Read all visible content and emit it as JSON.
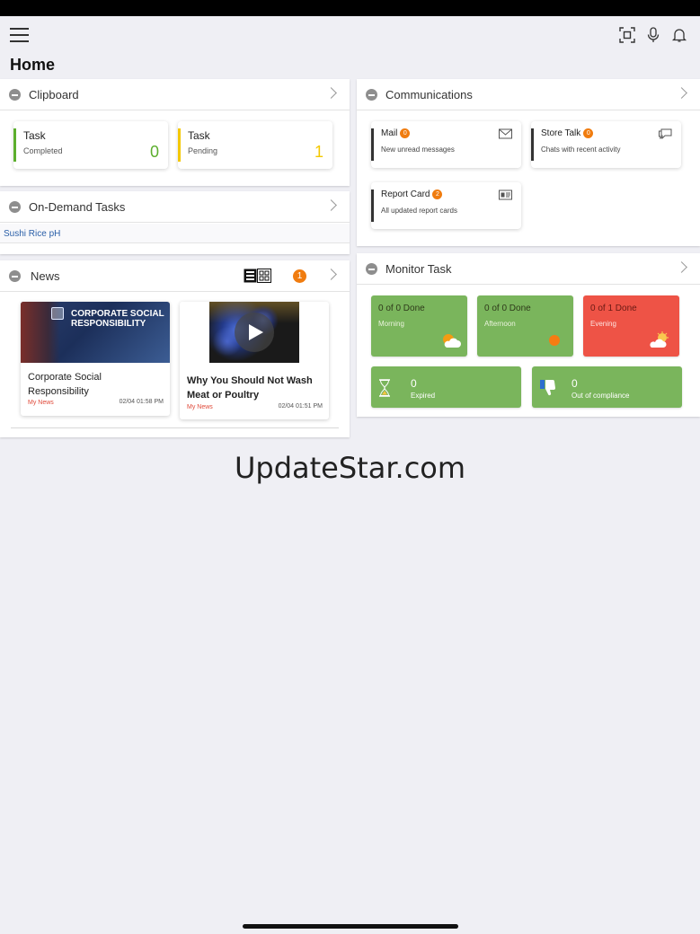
{
  "page": {
    "title": "Home"
  },
  "clipboard": {
    "title": "Clipboard",
    "tiles": [
      {
        "title": "Task",
        "subtitle": "Completed",
        "count": "0",
        "color": "#5cae2d"
      },
      {
        "title": "Task",
        "subtitle": "Pending",
        "count": "1",
        "color": "#f4c800"
      }
    ]
  },
  "on_demand": {
    "title": "On-Demand Tasks",
    "items": [
      "Sushi Rice pH"
    ]
  },
  "news": {
    "title": "News",
    "badge": "1",
    "items": [
      {
        "image_text": "CORPORATE SOCIAL RESPONSIBILITY",
        "title": "Corporate Social Responsibility",
        "source": "My News",
        "date": "02/04 01:58 PM"
      },
      {
        "title": "Why You Should Not Wash Meat or Poultry",
        "source": "My News",
        "date": "02/04 01:51 PM"
      }
    ]
  },
  "communications": {
    "title": "Communications",
    "tiles": [
      {
        "title": "Mail",
        "badge": "0",
        "subtitle": "New unread messages",
        "icon": "envelope-icon"
      },
      {
        "title": "Store Talk",
        "badge": "0",
        "subtitle": "Chats with recent activity",
        "icon": "chat-icon"
      },
      {
        "title": "Report Card",
        "badge": "2",
        "subtitle": "All updated report cards",
        "icon": "id-card-icon"
      }
    ]
  },
  "monitor_task": {
    "title": "Monitor Task",
    "shifts": [
      {
        "label": "0 of 0 Done",
        "sub": "Morning",
        "color": "#7ab55c",
        "icon": "partly-cloudy-icon"
      },
      {
        "label": "0 of 0 Done",
        "sub": "Afternoon",
        "color": "#7ab55c",
        "icon": "sun-icon"
      },
      {
        "label": "0 of 1 Done",
        "sub": "Evening",
        "color": "#ee5346",
        "icon": "cloud-sun-icon"
      }
    ],
    "stats": [
      {
        "count": "0",
        "label": "Expired",
        "icon": "hourglass-icon"
      },
      {
        "count": "0",
        "label": "Out of compliance",
        "icon": "thumbs-down-icon"
      }
    ]
  },
  "watermark": "UpdateStar.com"
}
